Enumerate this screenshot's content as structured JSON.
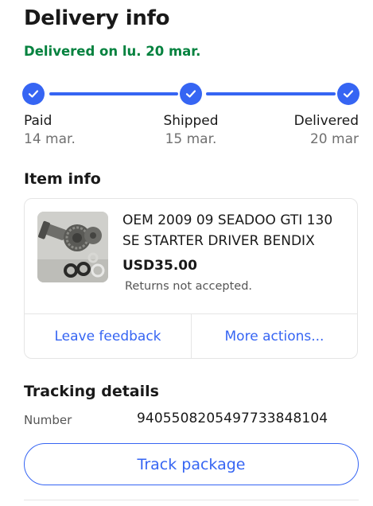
{
  "delivery": {
    "title": "Delivery info",
    "status": "Delivered on lu. 20 mar.",
    "accent_color": "#3665f3",
    "status_color": "#05823f",
    "steps": [
      {
        "name": "Paid",
        "date": "14 mar.",
        "icon": "check-icon"
      },
      {
        "name": "Shipped",
        "date": "15 mar.",
        "icon": "check-icon"
      },
      {
        "name": "Delivered",
        "date": "20 mar",
        "icon": "check-icon"
      }
    ]
  },
  "item": {
    "heading": "Item info",
    "title": "OEM 2009 09 SEADOO GTI 130 SE STARTER DRIVER BENDIX",
    "price": "USD35.00",
    "returns": "Returns not accepted.",
    "image_icon": "starter-gear-photo",
    "actions": {
      "leave_feedback": "Leave feedback",
      "more_actions": "More actions..."
    }
  },
  "tracking": {
    "heading": "Tracking details",
    "number_label": "Number",
    "number_value": "9405508205497733848104",
    "track_button": "Track package"
  }
}
